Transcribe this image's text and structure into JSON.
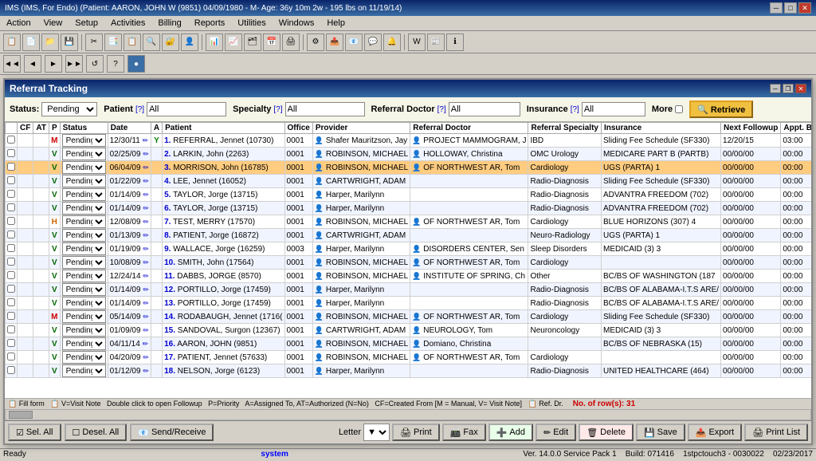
{
  "app": {
    "title": "IMS (IMS, For Endo)   (Patient: AARON, JOHN W (9851) 04/09/1980 - M- Age: 36y 10m 2w - 195 lbs on 11/19/14)",
    "title_short": "IMS",
    "menu": [
      "Action",
      "View",
      "Setup",
      "Activities",
      "Billing",
      "Reports",
      "Utilities",
      "Windows",
      "Help"
    ]
  },
  "toolbar2": {
    "nav_btns": [
      "◄◄",
      "◄",
      "►",
      "►►",
      "↺",
      "?",
      "🔵"
    ]
  },
  "referral_tracking": {
    "title": "Referral Tracking",
    "filters": {
      "status_label": "Status:",
      "status_value": "Pending",
      "patient_label": "Patient",
      "patient_hint": "[?]",
      "patient_value": "All",
      "specialty_label": "Specialty",
      "specialty_hint": "[?]",
      "specialty_value": "All",
      "referral_doctor_label": "Referral Doctor",
      "referral_doctor_hint": "[?]",
      "referral_doctor_value": "All",
      "insurance_label": "Insurance",
      "insurance_hint": "[?]",
      "insurance_value": "All",
      "more_label": "More",
      "retrieve_label": "Retrieve"
    },
    "table": {
      "columns": [
        "",
        "CF",
        "AT",
        "P",
        "Status",
        "Date",
        "A",
        "Patient",
        "Office",
        "Provider",
        "Referral Doctor",
        "Referral Specialty",
        "Insurance",
        "Next Followup",
        "Appt. Booked"
      ],
      "rows": [
        {
          "num": "1.",
          "cf": "",
          "at": "",
          "p": "M",
          "status": "Pending",
          "date": "12/30/11",
          "a": "Y",
          "patient": "REFERRAL, Jennet (10730)",
          "office": "0001",
          "provider": "Shafer Mauritzson, Jay",
          "ref_doctor": "PROJECT MAMMOGRAM, J",
          "specialty": "IBD",
          "insurance": "Sliding Fee Schedule (SF330)",
          "next_follow": "12/20/15",
          "appt": "03:00"
        },
        {
          "num": "2.",
          "cf": "",
          "at": "",
          "p": "V",
          "status": "Pending",
          "date": "02/25/09",
          "a": "",
          "patient": "LARKIN, John (2263)",
          "office": "0001",
          "provider": "ROBINSON, MICHAEL",
          "ref_doctor": "HOLLOWAY, Christina",
          "specialty": "OMC Urology",
          "insurance": "MEDICARE PART B (PARTB)",
          "next_follow": "00/00/00",
          "appt": "00:00"
        },
        {
          "num": "3.",
          "cf": "",
          "at": "",
          "p": "V",
          "status": "Pending",
          "date": "06/04/09",
          "a": "",
          "patient": "MORRISON, John (16785)",
          "office": "0001",
          "provider": "ROBINSON, MICHAEL",
          "ref_doctor": "OF NORTHWEST AR, Tom",
          "specialty": "Cardiology",
          "insurance": "UGS (PARTA) 1",
          "next_follow": "00/00/00",
          "appt": "00:00"
        },
        {
          "num": "4.",
          "cf": "",
          "at": "",
          "p": "V",
          "status": "Pending",
          "date": "01/22/09",
          "a": "",
          "patient": "LEE, Jennet (16052)",
          "office": "0001",
          "provider": "CARTWRIGHT, ADAM",
          "ref_doctor": "",
          "specialty": "Radio-Diagnosis",
          "insurance": "Sliding Fee Schedule (SF330)",
          "next_follow": "00/00/00",
          "appt": "00:00"
        },
        {
          "num": "5.",
          "cf": "",
          "at": "",
          "p": "V",
          "status": "Pending",
          "date": "01/14/09",
          "a": "",
          "patient": "TAYLOR, Jorge (13715)",
          "office": "0001",
          "provider": "Harper, Marilynn",
          "ref_doctor": "",
          "specialty": "Radio-Diagnosis",
          "insurance": "ADVANTRA FREEDOM (702)",
          "next_follow": "00/00/00",
          "appt": "00:00"
        },
        {
          "num": "6.",
          "cf": "",
          "at": "",
          "p": "V",
          "status": "Pending",
          "date": "01/14/09",
          "a": "",
          "patient": "TAYLOR, Jorge (13715)",
          "office": "0001",
          "provider": "Harper, Marilynn",
          "ref_doctor": "",
          "specialty": "Radio-Diagnosis",
          "insurance": "ADVANTRA FREEDOM (702)",
          "next_follow": "00/00/00",
          "appt": "00:00"
        },
        {
          "num": "7.",
          "cf": "",
          "at": "",
          "p": "H",
          "status": "Pending",
          "date": "12/08/09",
          "a": "",
          "patient": "TEST, MERRY (17570)",
          "office": "0001",
          "provider": "ROBINSON, MICHAEL",
          "ref_doctor": "OF NORTHWEST AR, Tom",
          "specialty": "Cardiology",
          "insurance": "BLUE HORIZONS (307) 4",
          "next_follow": "00/00/00",
          "appt": "00:00"
        },
        {
          "num": "8.",
          "cf": "",
          "at": "",
          "p": "V",
          "status": "Pending",
          "date": "01/13/09",
          "a": "",
          "patient": "PATIENT, Jorge (16872)",
          "office": "0001",
          "provider": "CARTWRIGHT, ADAM",
          "ref_doctor": "",
          "specialty": "Neuro-Radiology",
          "insurance": "UGS (PARTA) 1",
          "next_follow": "00/00/00",
          "appt": "00:00"
        },
        {
          "num": "9.",
          "cf": "",
          "at": "",
          "p": "V",
          "status": "Pending",
          "date": "01/19/09",
          "a": "",
          "patient": "WALLACE, Jorge (16259)",
          "office": "0003",
          "provider": "Harper, Marilynn",
          "ref_doctor": "DISORDERS CENTER, Sen",
          "specialty": "Sleep Disorders",
          "insurance": "MEDICAID (3) 3",
          "next_follow": "00/00/00",
          "appt": "00:00"
        },
        {
          "num": "10.",
          "cf": "",
          "at": "",
          "p": "V",
          "status": "Pending",
          "date": "10/08/09",
          "a": "",
          "patient": "SMITH, John (17564)",
          "office": "0001",
          "provider": "ROBINSON, MICHAEL",
          "ref_doctor": "OF NORTHWEST AR, Tom",
          "specialty": "Cardiology",
          "insurance": "",
          "next_follow": "00/00/00",
          "appt": "00:00"
        },
        {
          "num": "11.",
          "cf": "",
          "at": "",
          "p": "V",
          "status": "Pending",
          "date": "12/24/14",
          "a": "",
          "patient": "DABBS, JORGE (8570)",
          "office": "0001",
          "provider": "ROBINSON, MICHAEL",
          "ref_doctor": "INSTITUTE OF SPRING, Ch",
          "specialty": "Other",
          "insurance": "BC/BS OF WASHINGTON (187",
          "next_follow": "00/00/00",
          "appt": "00:00"
        },
        {
          "num": "12.",
          "cf": "",
          "at": "",
          "p": "V",
          "status": "Pending",
          "date": "01/14/09",
          "a": "",
          "patient": "PORTILLO, Jorge (17459)",
          "office": "0001",
          "provider": "Harper, Marilynn",
          "ref_doctor": "",
          "specialty": "Radio-Diagnosis",
          "insurance": "BC/BS OF ALABAMA-I.T.S ARE/",
          "next_follow": "00/00/00",
          "appt": "00:00"
        },
        {
          "num": "13.",
          "cf": "",
          "at": "",
          "p": "V",
          "status": "Pending",
          "date": "01/14/09",
          "a": "",
          "patient": "PORTILLO, Jorge (17459)",
          "office": "0001",
          "provider": "Harper, Marilynn",
          "ref_doctor": "",
          "specialty": "Radio-Diagnosis",
          "insurance": "BC/BS OF ALABAMA-I.T.S ARE/",
          "next_follow": "00/00/00",
          "appt": "00:00"
        },
        {
          "num": "14.",
          "cf": "",
          "at": "",
          "p": "M",
          "status": "Pending",
          "date": "05/14/09",
          "a": "",
          "patient": "RODABAUGH, Jennet (1716(",
          "office": "0001",
          "provider": "ROBINSON, MICHAEL",
          "ref_doctor": "OF NORTHWEST AR, Tom",
          "specialty": "Cardiology",
          "insurance": "Sliding Fee Schedule (SF330)",
          "next_follow": "00/00/00",
          "appt": "00:00"
        },
        {
          "num": "15.",
          "cf": "",
          "at": "",
          "p": "V",
          "status": "Pending",
          "date": "01/09/09",
          "a": "",
          "patient": "SANDOVAL, Surgon (12367)",
          "office": "0001",
          "provider": "CARTWRIGHT, ADAM",
          "ref_doctor": "NEUROLOGY, Tom",
          "specialty": "Neuroncology",
          "insurance": "MEDICAID (3) 3",
          "next_follow": "00/00/00",
          "appt": "00:00"
        },
        {
          "num": "16.",
          "cf": "",
          "at": "",
          "p": "V",
          "status": "Pending",
          "date": "04/11/14",
          "a": "",
          "patient": "AARON, JOHN (9851)",
          "office": "0001",
          "provider": "ROBINSON, MICHAEL",
          "ref_doctor": "Domiano, Christina",
          "specialty": "",
          "insurance": "BC/BS OF NEBRASKA (15)",
          "next_follow": "00/00/00",
          "appt": "00:00"
        },
        {
          "num": "17.",
          "cf": "",
          "at": "",
          "p": "V",
          "status": "Pending",
          "date": "04/20/09",
          "a": "",
          "patient": "PATIENT, Jennet (57633)",
          "office": "0001",
          "provider": "ROBINSON, MICHAEL",
          "ref_doctor": "OF NORTHWEST AR, Tom",
          "specialty": "Cardiology",
          "insurance": "",
          "next_follow": "00/00/00",
          "appt": "00:00"
        },
        {
          "num": "18.",
          "cf": "",
          "at": "",
          "p": "V",
          "status": "Pending",
          "date": "01/12/09",
          "a": "",
          "patient": "NELSON, Jorge (6123)",
          "office": "0001",
          "provider": "Harper, Marilynn",
          "ref_doctor": "",
          "specialty": "Radio-Diagnosis",
          "insurance": "UNITED HEALTHCARE (464)",
          "next_follow": "00/00/00",
          "appt": "00:00"
        }
      ]
    },
    "status_bar": {
      "hint": "Fill form   V=Visit Note  Double click to open Followup  P=Priority  A=Assigned To, AT=Authorized (N=No)  CF=Created From [M = Manual, V= Visit Note]",
      "ref_dr": "Ref. Dr.",
      "count_label": "No. of row(s): 31"
    }
  },
  "bottom_toolbar": {
    "sel_all": "Sel. All",
    "desel_all": "Desel. All",
    "send_receive": "Send/Receive",
    "letter": "Letter",
    "print": "Print",
    "fax": "Fax",
    "add": "Add",
    "edit": "Edit",
    "delete": "Delete",
    "save": "Save",
    "export": "Export",
    "print_list": "Print List"
  },
  "app_status": {
    "ready": "Ready",
    "system": "system",
    "version": "Ver. 14.0.0 Service Pack 1",
    "build": "Build: 071416",
    "server": "1stpctouch3 - 0030022",
    "date": "02/23/2017"
  },
  "icons": {
    "minimize": "─",
    "maximize": "□",
    "close": "✕",
    "restore": "❐"
  }
}
